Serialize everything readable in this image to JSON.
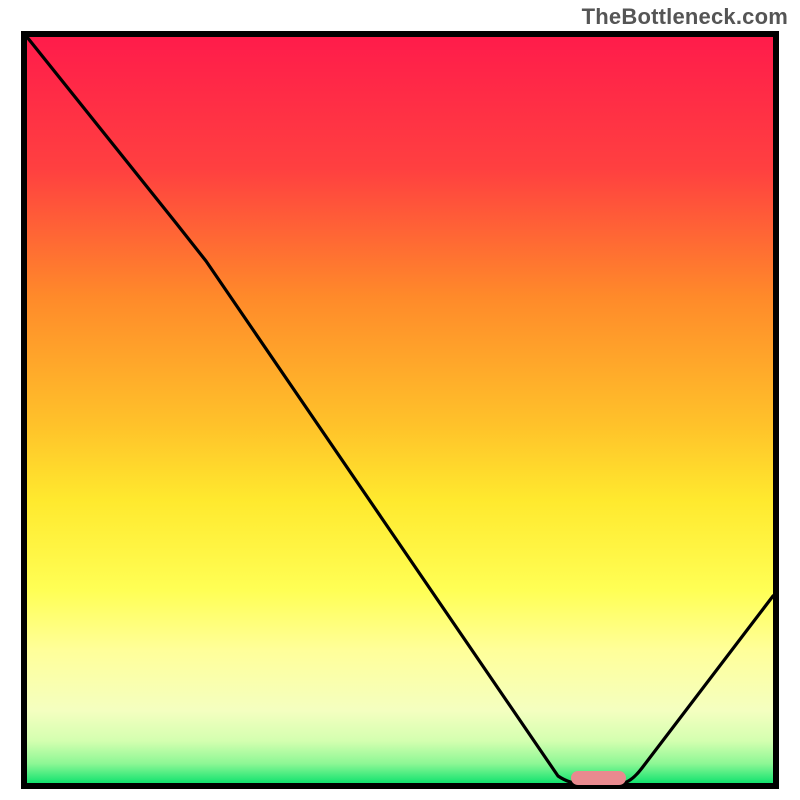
{
  "watermark": "TheBottleneck.com",
  "chart_data": {
    "type": "line",
    "title": "",
    "xlabel": "",
    "ylabel": "",
    "xlim": [
      0,
      100
    ],
    "ylim": [
      0,
      100
    ],
    "grid": false,
    "legend": false,
    "background": {
      "type": "gradient-vertical",
      "stops": [
        {
          "pos": 0,
          "color": "#ff1b4b"
        },
        {
          "pos": 35,
          "color": "#ff8a2a"
        },
        {
          "pos": 62,
          "color": "#ffe92e"
        },
        {
          "pos": 82,
          "color": "#ffff9a"
        },
        {
          "pos": 94,
          "color": "#eaffb0"
        },
        {
          "pos": 100,
          "color": "#00e06a"
        }
      ]
    },
    "series": [
      {
        "name": "bottleneck-curve",
        "color": "#000000",
        "x": [
          0,
          20,
          24,
          72,
          80,
          100
        ],
        "y": [
          100,
          75,
          70,
          0,
          0,
          25
        ]
      }
    ],
    "marker": {
      "name": "optimal-range",
      "color": "#e98a8f",
      "x_start": 73,
      "x_end": 80,
      "y": 0.8
    }
  }
}
